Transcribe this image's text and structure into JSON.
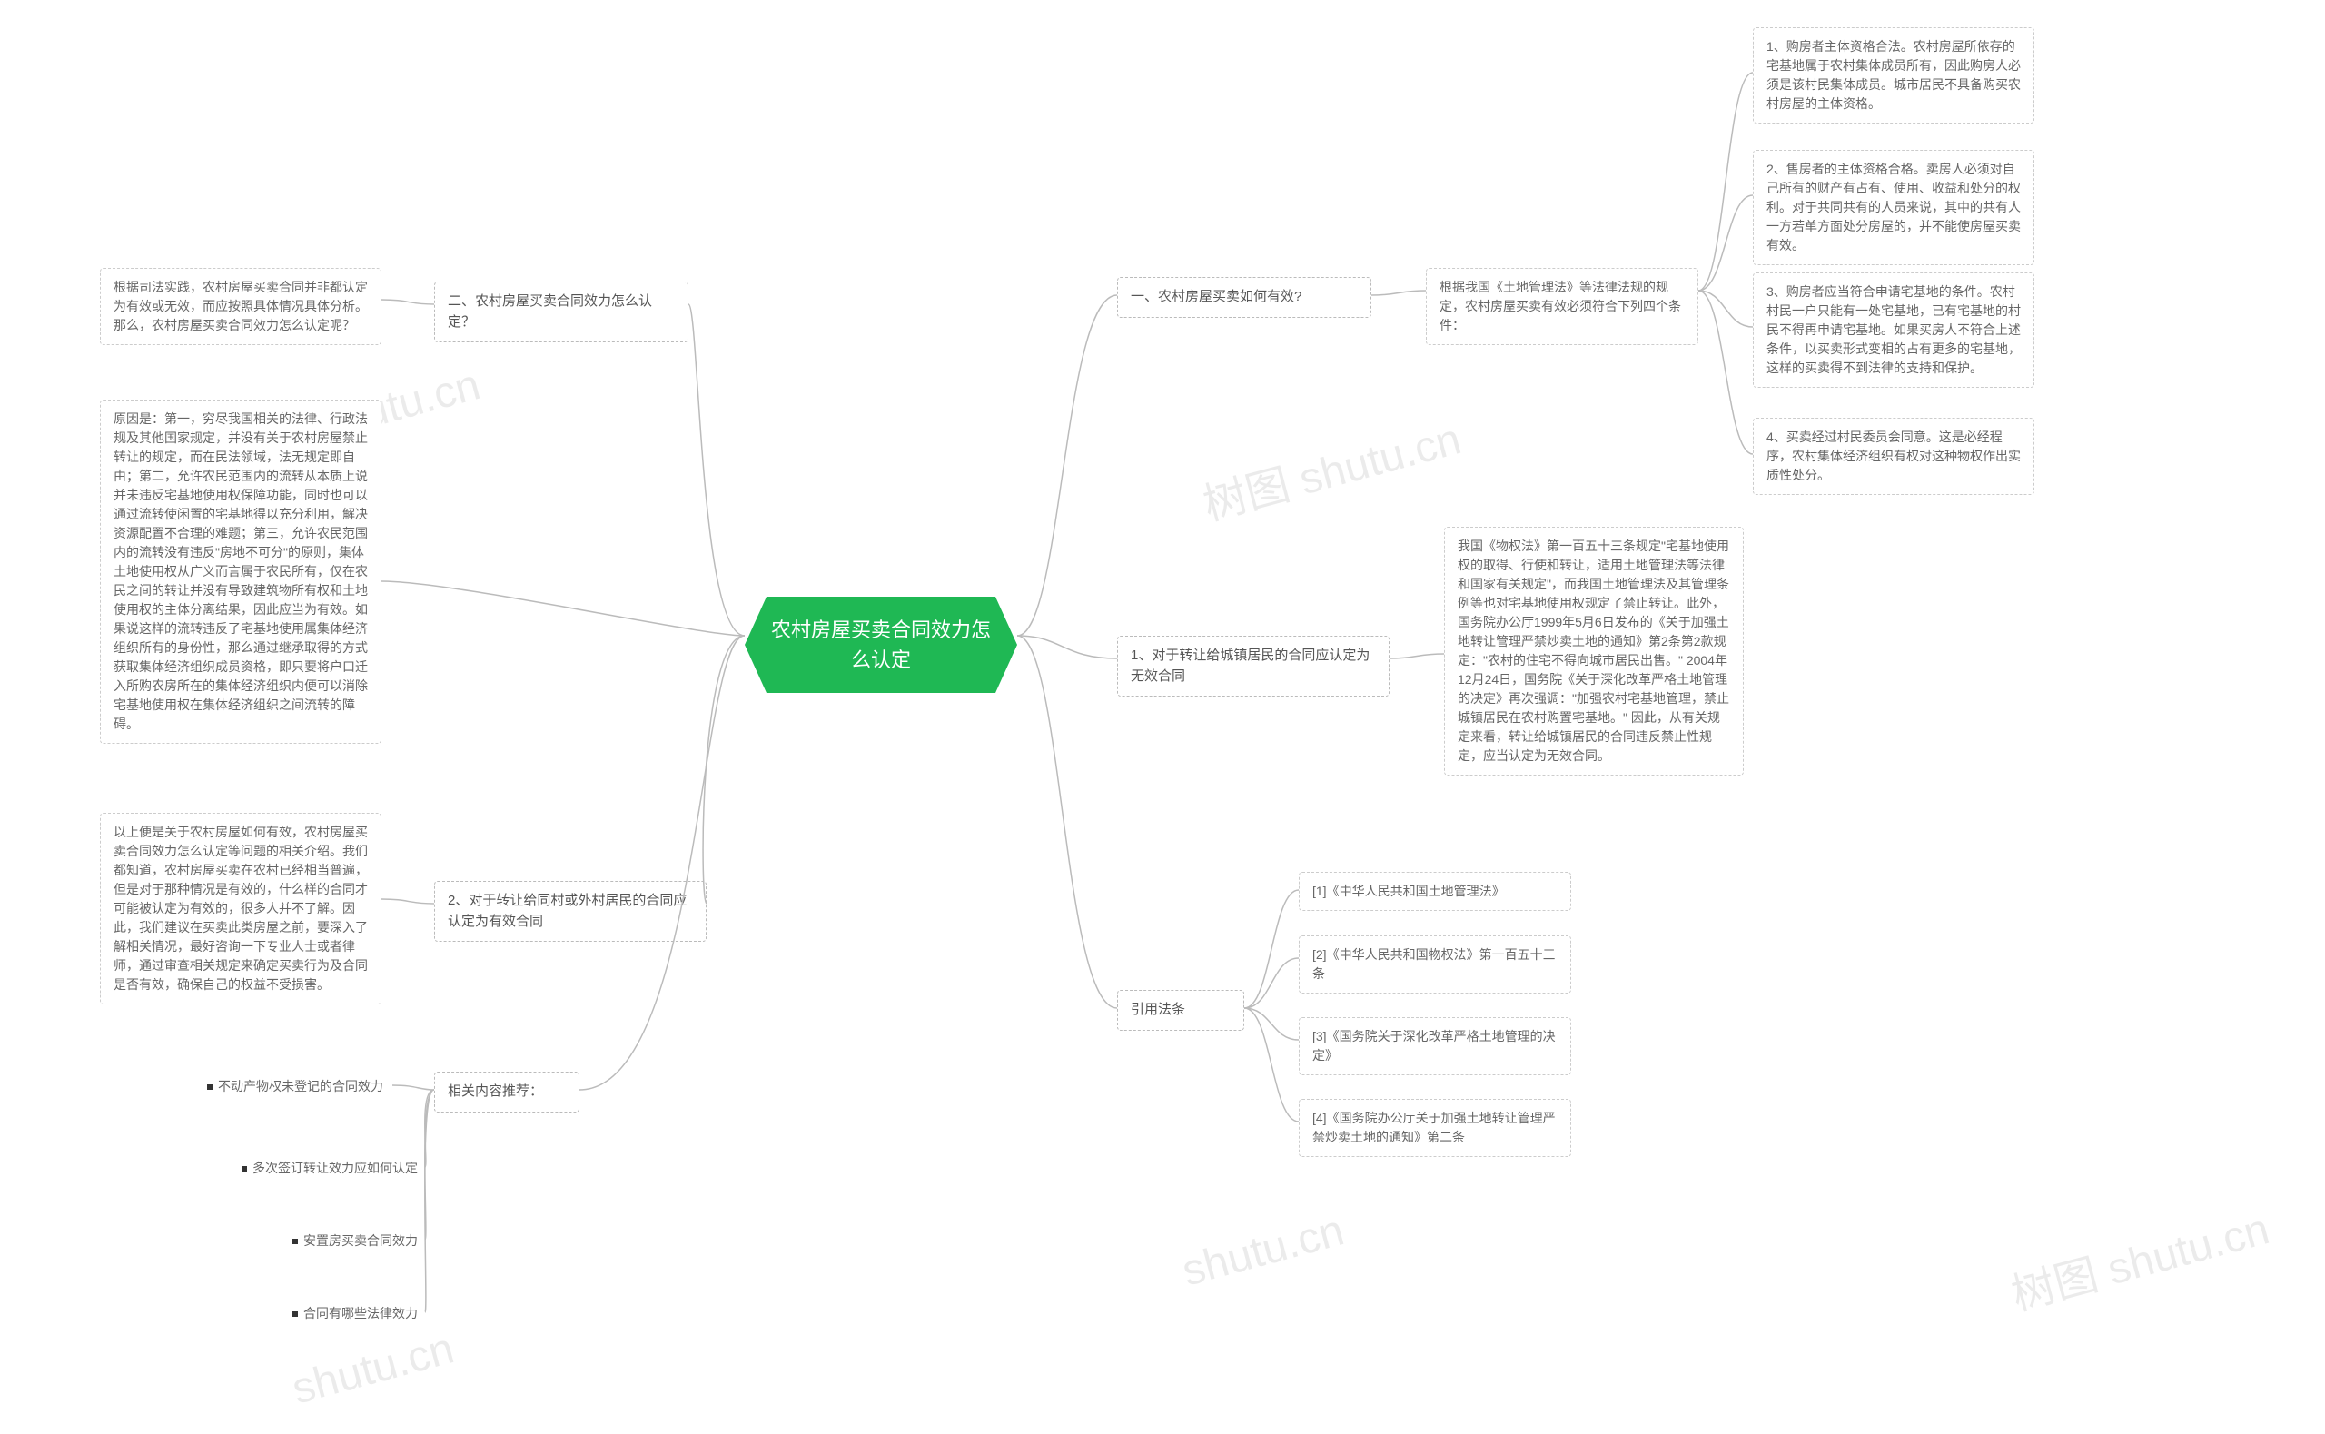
{
  "watermarks": [
    "树图 shutu.cn",
    "shutu.cn",
    "树图 shutu.cn",
    "shutu.cn",
    "树图 shutu.cn"
  ],
  "root": "农村房屋买卖合同效力怎么认定",
  "right": {
    "b1": {
      "title": "一、农村房屋买卖如何有效?",
      "mid": "根据我国《土地管理法》等法律法规的规定，农村房屋买卖有效必须符合下列四个条件：",
      "leaves": [
        "1、购房者主体资格合法。农村房屋所依存的宅基地属于农村集体成员所有，因此购房人必须是该村民集体成员。城市居民不具备购买农村房屋的主体资格。",
        "2、售房者的主体资格合格。卖房人必须对自己所有的财产有占有、使用、收益和处分的权利。对于共同共有的人员来说，其中的共有人一方若单方面处分房屋的，并不能使房屋买卖有效。",
        "3、购房者应当符合申请宅基地的条件。农村村民一户只能有一处宅基地，已有宅基地的村民不得再申请宅基地。如果买房人不符合上述条件，以买卖形式变相的占有更多的宅基地，这样的买卖得不到法律的支持和保护。",
        "4、买卖经过村民委员会同意。这是必经程序，农村集体经济组织有权对这种物权作出实质性处分。"
      ]
    },
    "b2": {
      "title": "1、对于转让给城镇居民的合同应认定为无效合同",
      "leaf": "我国《物权法》第一百五十三条规定\"宅基地使用权的取得、行使和转让，适用土地管理法等法律和国家有关规定\"，而我国土地管理法及其管理条例等也对宅基地使用权规定了禁止转让。此外，国务院办公厅1999年5月6日发布的《关于加强土地转让管理严禁炒卖土地的通知》第2条第2款规定：\"农村的住宅不得向城市居民出售。\" 2004年12月24日，国务院《关于深化改革严格土地管理的决定》再次强调：\"加强农村宅基地管理，禁止城镇居民在农村购置宅基地。\" 因此，从有关规定来看，转让给城镇居民的合同违反禁止性规定，应当认定为无效合同。"
    },
    "b3": {
      "title": "引用法条",
      "leaves": [
        "[1]《中华人民共和国土地管理法》",
        "[2]《中华人民共和国物权法》第一百五十三条",
        "[3]《国务院关于深化改革严格土地管理的决定》",
        "[4]《国务院办公厅关于加强土地转让管理严禁炒卖土地的通知》第二条"
      ]
    }
  },
  "left": {
    "b1": {
      "title": "二、农村房屋买卖合同效力怎么认定？",
      "leaf": "根据司法实践，农村房屋买卖合同并非都认定为有效或无效，而应按照具体情况具体分析。那么，农村房屋买卖合同效力怎么认定呢？"
    },
    "b2_leaf": "原因是：第一，穷尽我国相关的法律、行政法规及其他国家规定，并没有关于农村房屋禁止转让的规定，而在民法领域，法无规定即自由；第二，允许农民范围内的流转从本质上说并未违反宅基地使用权保障功能，同时也可以通过流转使闲置的宅基地得以充分利用，解决资源配置不合理的难题；第三，允许农民范围内的流转没有违反\"房地不可分\"的原则，集体土地使用权从广义而言属于农民所有，仅在农民之间的转让并没有导致建筑物所有权和土地使用权的主体分离结果，因此应当为有效。如果说这样的流转违反了宅基地使用属集体经济组织所有的身份性，那么通过继承取得的方式获取集体经济组织成员资格，即只要将户口迁入所购农房所在的集体经济组织内便可以消除宅基地使用权在集体经济组织之间流转的障碍。",
    "b3": {
      "title": "2、对于转让给同村或外村居民的合同应认定为有效合同",
      "leaf": "以上便是关于农村房屋如何有效，农村房屋买卖合同效力怎么认定等问题的相关介绍。我们都知道，农村房屋买卖在农村已经相当普遍，但是对于那种情况是有效的，什么样的合同才可能被认定为有效的，很多人并不了解。因此，我们建议在买卖此类房屋之前，要深入了解相关情况，最好咨询一下专业人士或者律师，通过审查相关规定来确定买卖行为及合同是否有效，确保自己的权益不受损害。"
    },
    "b4": {
      "title": "相关内容推荐：",
      "leaves": [
        "不动产物权未登记的合同效力",
        "多次签订转让效力应如何认定",
        "安置房买卖合同效力",
        "合同有哪些法律效力"
      ]
    }
  }
}
